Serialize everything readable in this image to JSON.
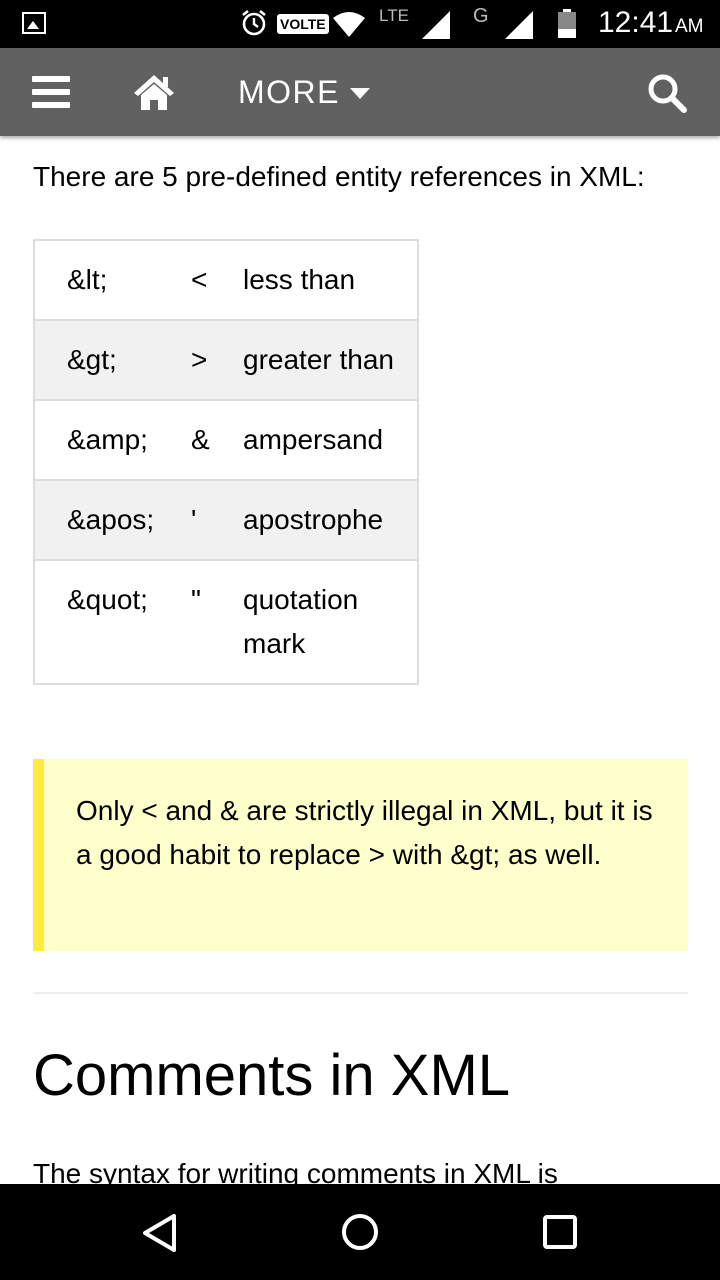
{
  "status_bar": {
    "volte_label": "VOLTE",
    "network_label": "LTE",
    "network2_label": "G",
    "time": "12:41",
    "ampm": "AM"
  },
  "app_bar": {
    "more_label": "MORE"
  },
  "content": {
    "intro": "There are 5 pre-defined entity references in XML:",
    "entities": [
      {
        "entity": "&lt;",
        "symbol": "<",
        "meaning": "less than"
      },
      {
        "entity": "&gt;",
        "symbol": ">",
        "meaning": "greater than"
      },
      {
        "entity": "&amp;",
        "symbol": "&",
        "meaning": "ampersand"
      },
      {
        "entity": "&apos;",
        "symbol": "'",
        "meaning": "apostrophe"
      },
      {
        "entity": "&quot;",
        "symbol": "\"",
        "meaning": "quotation mark"
      }
    ],
    "note": "Only < and & are strictly illegal in XML, but it is a good habit to replace > with &gt; as well.",
    "heading": "Comments in XML",
    "paragraph_start": "The syntax for writing comments in XML is"
  },
  "colors": {
    "app_bar": "#616161",
    "note_background": "#ffffcc",
    "note_border": "#ffeb3b",
    "alt_row": "#f1f1f1"
  },
  "icons": [
    "gallery-icon",
    "alarm-clock-icon",
    "wifi-icon",
    "signal-icon",
    "battery-icon",
    "menu-icon",
    "home-icon",
    "chevron-down-icon",
    "search-icon",
    "back-icon",
    "home-circle-icon",
    "recent-apps-icon"
  ]
}
